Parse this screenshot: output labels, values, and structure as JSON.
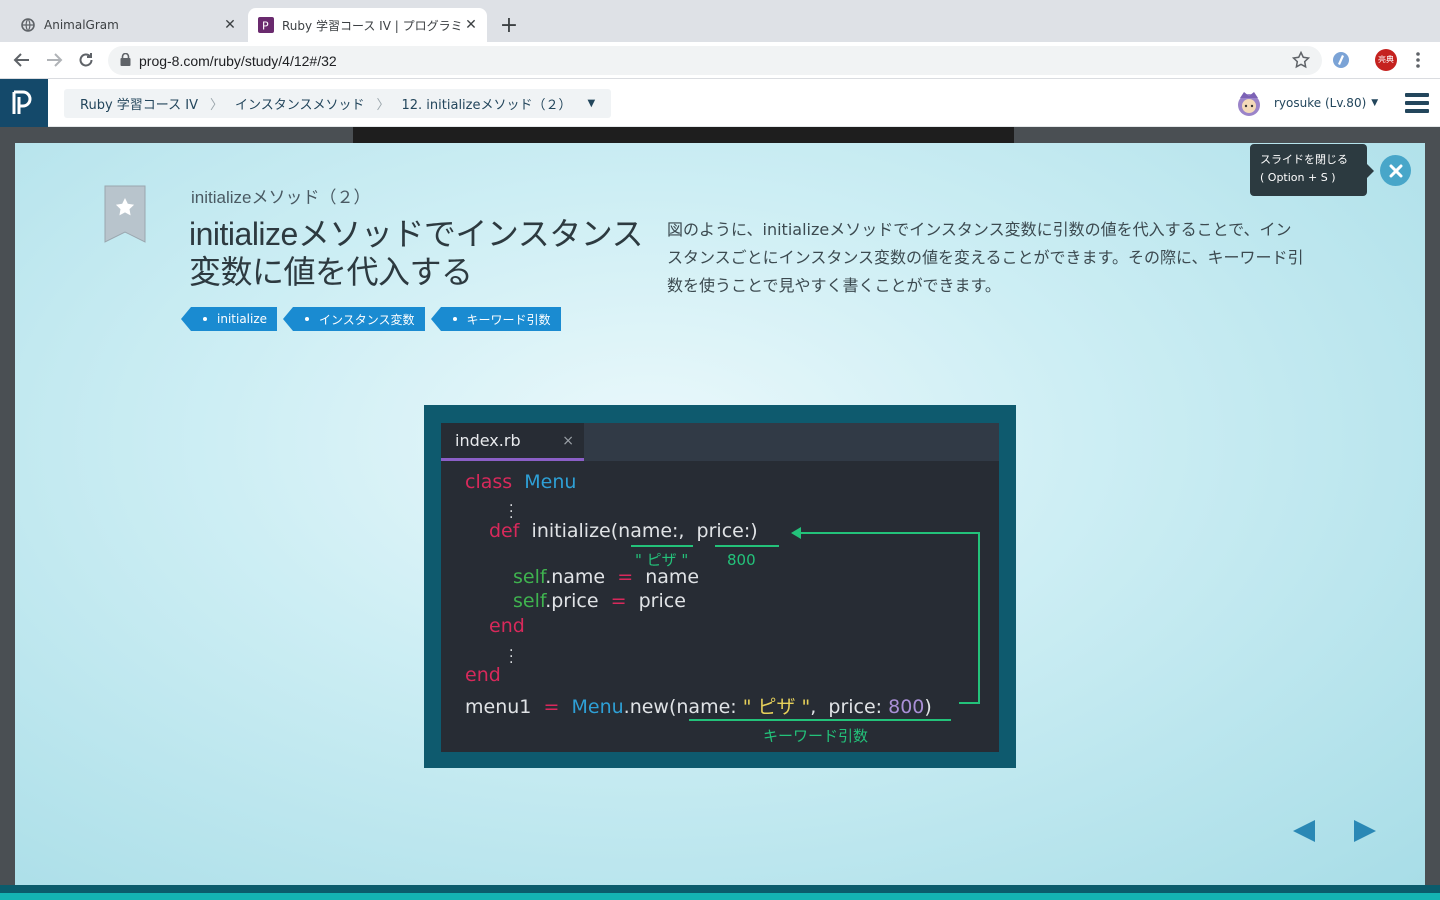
{
  "browser": {
    "tabs": [
      {
        "title": "AnimalGram",
        "active": false,
        "icon": "globe-icon"
      },
      {
        "title": "Ruby 学習コース IV | プログラミング",
        "active": true,
        "icon": "progate-favicon"
      }
    ],
    "url": "prog-8.com/ruby/study/4/12#/32",
    "extension_badge": "亮典"
  },
  "header": {
    "breadcrumb": [
      "Ruby 学習コース IV",
      "インスタンスメソッド",
      "12. initializeメソッド（２）"
    ],
    "user": "ryosuke (Lv.80)"
  },
  "slide": {
    "subtitle": "initializeメソッド（２）",
    "title": "initializeメソッドでインスタンス変数に値を代入する",
    "tags": [
      "initialize",
      "インスタンス変数",
      "キーワード引数"
    ],
    "description": "図のように、initializeメソッドでインスタンス変数に引数の値を代入することで、インスタンスごとにインスタンス変数の値を変えることができます。その際に、キーワード引数を使うことで見やすく書くことができます。",
    "tooltip_line1": "スライドを閉じる",
    "tooltip_line2": "( Option + S )",
    "code": {
      "filename": "index.rb",
      "class_kw": "class",
      "class_name": "Menu",
      "def_kw": "def",
      "def_sig": "initialize(name:,  price:)",
      "annot_name": "\" ピザ \"",
      "annot_price": "800",
      "line_self_name_self": "self",
      "line_self_name_attr": ".name",
      "line_self_name_eq": "=",
      "line_self_name_val": "name",
      "line_self_price_self": "self",
      "line_self_price_attr": ".price",
      "line_self_price_eq": "=",
      "line_self_price_val": "price",
      "end1": "end",
      "end2": "end",
      "call_var": "menu1",
      "call_eq": "=",
      "call_class": "Menu",
      "call_new": ".new(name: ",
      "call_str": "\" ピザ \"",
      "call_mid": ",  price: ",
      "call_num": "800",
      "call_close": ")",
      "annot_keyword": "キーワード引数"
    }
  },
  "colors": {
    "accent": "#1a8bd1",
    "header_logo": "#14496a",
    "code_bg": "#272c34",
    "figure_frame": "#0e5a6e",
    "annotation": "#23c27a"
  }
}
